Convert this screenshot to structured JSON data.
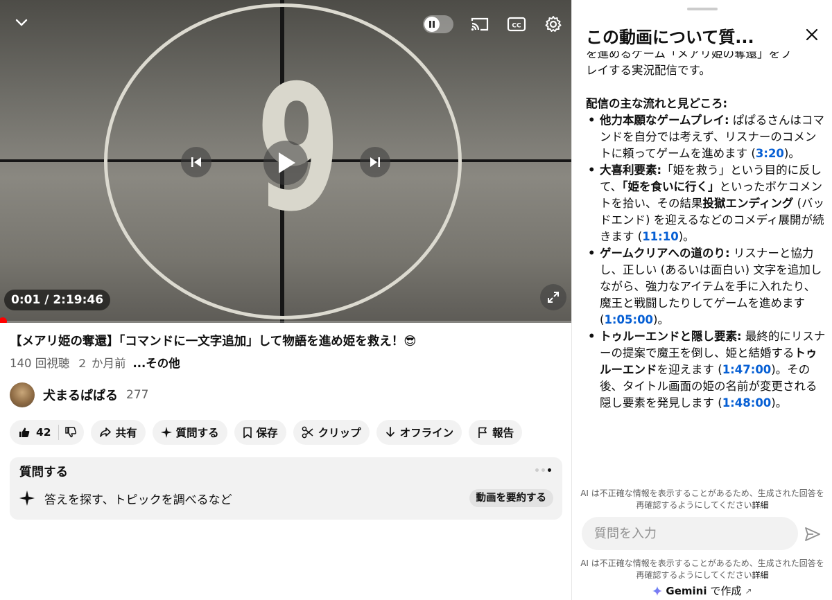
{
  "player": {
    "countdown_number": "9",
    "time_display": "0:01 / 2:19:46",
    "progress_fraction": 0.0001,
    "controls": {
      "collapse": "chevron-down-icon",
      "pause": "pause-icon",
      "cast": "cast-icon",
      "cc": "CC",
      "settings": "gear-icon",
      "previous": "skip-previous-icon",
      "play": "play-icon",
      "next": "skip-next-icon",
      "fullscreen": "fullscreen-icon"
    },
    "accent_color": "#ff0000"
  },
  "video": {
    "title": "【メアリ姫の奪還】「コマンドに一文字追加」して物語を進め姫を救え！😎",
    "views": "140 回視聴",
    "age": "２ か月前",
    "more": "...その他"
  },
  "channel": {
    "name": "犬まるぱぱる",
    "subscribers": "277"
  },
  "actions": {
    "likes": "42",
    "share": "共有",
    "ask": "質問する",
    "save": "保存",
    "clip": "クリップ",
    "offline": "オフライン",
    "report": "報告"
  },
  "ask_card": {
    "title": "質問する",
    "placeholder": "答えを探す、トピックを調べるなど",
    "summarize": "動画を要約する"
  },
  "panel": {
    "title": "この動画について質...",
    "clipped_line": "を進めるゲーム「メアリ姫の奪還」をプ",
    "intro_tail": "レイする実況配信です。",
    "section_heading": "配信の主な流れと見どころ:",
    "bullets": [
      {
        "head": "他力本願なゲームプレイ:",
        "text": " ぱぱるさんはコマンドを自分では考えず、リスナーのコメントに頼ってゲームを進めます (",
        "ts": "3:20",
        "tail": ")。"
      },
      {
        "head": "大喜利要素:",
        "t1": "「姫を救う」という目的に反して、",
        "b1": "「姫を食いに行く」",
        "t2": "といったボケコメントを拾い、その結果",
        "b2": "投獄エンディング",
        "t3": " (バッドエンド) を迎えるなどのコメディ展開が続きます (",
        "ts": "11:10",
        "tail": ")。"
      },
      {
        "head": "ゲームクリアへの道のり:",
        "text": " リスナーと協力し、正しい (あるいは面白い) 文字を追加しながら、強力なアイテムを手に入れたり、魔王と戦闘したりしてゲームを進めます (",
        "ts": "1:05:00",
        "tail": ")。"
      },
      {
        "head": "トゥルーエンドと隠し要素:",
        "t1": " 最終的にリスナーの提案で魔王を倒し、姫と結婚する",
        "b1": "トゥルーエンド",
        "t2": "を迎えます (",
        "ts": "1:47:00",
        "t3": ")。その後、タイトル画面の姫の名前が変更される隠し要素を発見します (",
        "ts2": "1:48:00",
        "tail": ")。"
      }
    ],
    "disclaimer": "AI は不正確な情報を表示することがあるため、生成された回答を再確認するようにしてください",
    "disclaimer_link": "詳細",
    "input_placeholder": "質問を入力",
    "footer_brand": "Gemini",
    "footer_suffix": "で作成",
    "footer_arrow": "↗"
  }
}
